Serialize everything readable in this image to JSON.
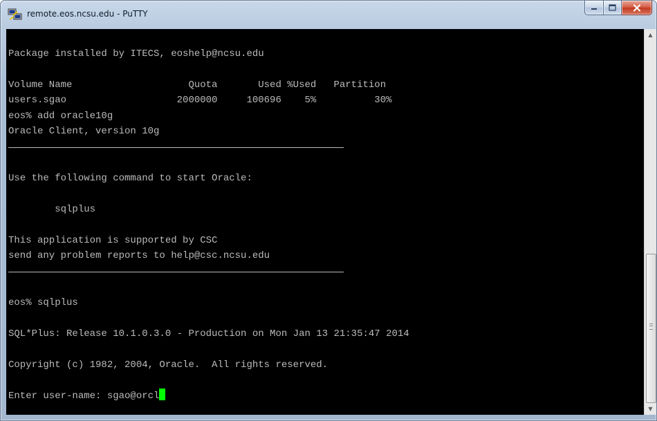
{
  "window": {
    "title": "remote.eos.ncsu.edu - PuTTY",
    "caption_buttons": [
      "minimize",
      "maximize",
      "close"
    ]
  },
  "terminal": {
    "lines": [
      "",
      "Package installed by ITECS, eoshelp@ncsu.edu",
      "",
      "Volume Name                    Quota       Used %Used   Partition",
      "users.sgao                   2000000     100696    5%          30%",
      "eos% add oracle10g",
      "Oracle Client, version 10g",
      "",
      "",
      "Use the following command to start Oracle:",
      "",
      "        sqlplus",
      "",
      "This application is supported by CSC",
      "send any problem reports to help@csc.ncsu.edu",
      "",
      "",
      "eos% sqlplus",
      "",
      "SQL*Plus: Release 10.1.0.3.0 - Production on Mon Jan 13 21:35:47 2014",
      "",
      "Copyright (c) 1982, 2004, Oracle.  All rights reserved.",
      "",
      "Enter user-name: sgao@orcl"
    ],
    "rule_line_indices": [
      7,
      15
    ],
    "cursor_color": "#00ff00",
    "text_color": "#bbbbbb",
    "background_color": "#000000"
  },
  "scrollbar": {
    "up_icon": "arrow-up-icon",
    "down_icon": "arrow-down-icon"
  }
}
